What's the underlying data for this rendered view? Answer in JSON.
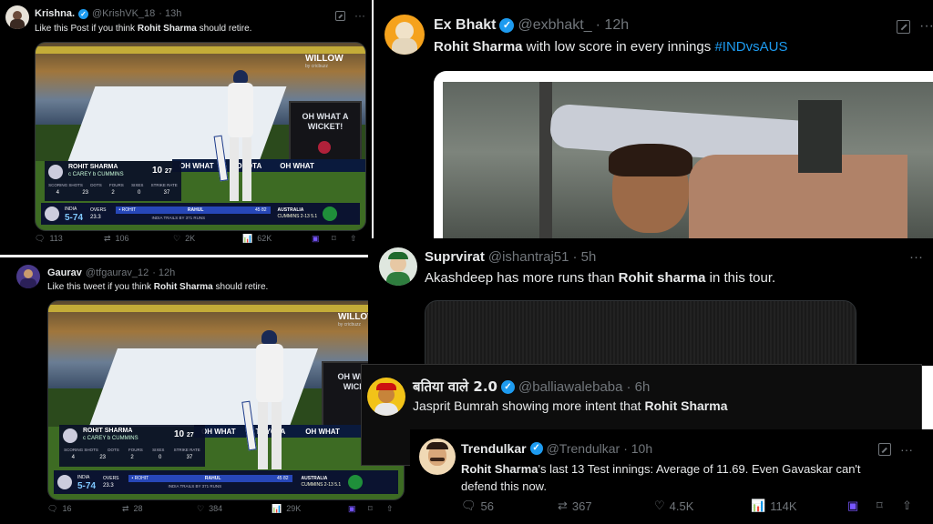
{
  "post1": {
    "name": "Krishna.",
    "handle": "@KrishVK_18",
    "time": "· 13h",
    "text_pre": "Like this Post if you think ",
    "text_bold": "Rohit Sharma",
    "text_post": " should retire.",
    "replies": "113",
    "reposts": "106",
    "likes": "2K",
    "views": "62K"
  },
  "post2": {
    "name": "Gaurav",
    "handle": "@tfgaurav_12",
    "time": "· 12h",
    "text_pre": "Like this tweet if you think ",
    "text_bold": "Rohit Sharma",
    "text_post": " should retire.",
    "replies": "16",
    "reposts": "28",
    "likes": "384",
    "views": "29K"
  },
  "post3": {
    "name": "Ex Bhakt",
    "handle": "@exbhakt_",
    "time": "· 12h",
    "text_bold": "Rohit Sharma",
    "text_post": " with low score in every innings ",
    "hashtag": "#INDvsAUS"
  },
  "post4": {
    "name": "Suprvirat",
    "handle": "@ishantraj51",
    "time": "· 5h",
    "text_pre": "Akashdeep has more runs than ",
    "text_bold": "Rohit sharma",
    "text_post": " in this tour."
  },
  "post5": {
    "name": "बतिया वाले 2.0",
    "handle": "@balliawalebaba",
    "time": "· 6h",
    "text_pre": "Jasprit Bumrah showing more intent that ",
    "text_bold": "Rohit Sharma"
  },
  "post6": {
    "name": "Trendulkar",
    "handle": "@Trendulkar",
    "time": "· 10h",
    "text_bold": "Rohit Sharma",
    "text_line1": "'s last 13 Test innings: Average of 11.69. Even Gavaskar can't",
    "text_line2": "defend this now.",
    "replies": "56",
    "reposts": "367",
    "likes": "4.5K",
    "views": "114K"
  },
  "broadcast": {
    "watermark": "WILLOW",
    "watermark_sub": "by cricbuzz",
    "sign": "OH WHAT A WICKET!",
    "board": "OH WHAT",
    "sponsor": "TOYOTA",
    "batter_name": "ROHIT SHARMA",
    "dismissal": "c CAREY  b CUMMINS",
    "runs": "10",
    "balls": "27",
    "stat_labels": [
      "SCORING SHOTS",
      "DOTS",
      "FOURS",
      "SIXES",
      "STRIKE RATE"
    ],
    "stat_values": [
      "4",
      "23",
      "2",
      "0",
      "37"
    ],
    "team": "INDIA",
    "score": "5-74",
    "overs_label": "OVERS",
    "overs": "23.3",
    "out_batter": "• ROHIT",
    "next_batter": "RAHUL",
    "next_runs": "45",
    "next_balls": "82",
    "trail": "INDIA TRAILS BY 371 RUNS",
    "opp": "AUSTRALIA",
    "bowler": "CUMMINS 2-13 5.1"
  },
  "colors": {
    "bg": "#000000",
    "text": "#e7e9ea",
    "muted": "#71767b",
    "accent": "#1d9bf0",
    "bookmark": "#7856ff"
  }
}
